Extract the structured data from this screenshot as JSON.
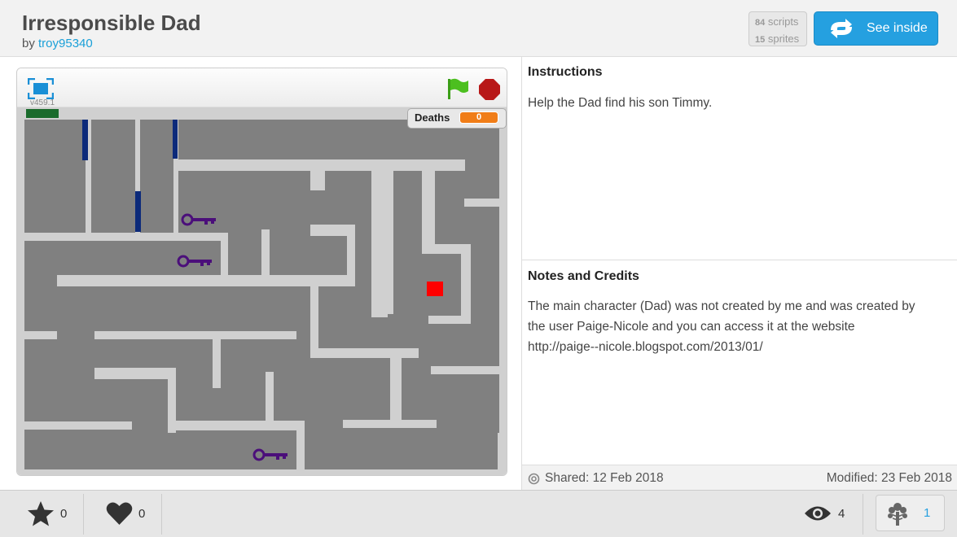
{
  "project": {
    "title": "Irresponsible Dad",
    "by_label": "by",
    "author": "troy95340"
  },
  "stats": {
    "scripts_count": "84",
    "scripts_label": "scripts",
    "sprites_count": "15",
    "sprites_label": "sprites"
  },
  "see_inside_label": "See inside",
  "player": {
    "version": "v459.1",
    "deaths_label": "Deaths",
    "deaths_value": "0"
  },
  "instructions": {
    "heading": "Instructions",
    "text": "Help the Dad find his son Timmy."
  },
  "notes": {
    "heading": "Notes and Credits",
    "lines": [
      "The main character (Dad) was not created by me and was created by",
      "the user Paige-Nicole and you can access it at the website",
      "http://paige--nicole.blogspot.com/2013/01/"
    ]
  },
  "meta": {
    "shared": "Shared: 12 Feb 2018",
    "modified": "Modified: 23 Feb 2018"
  },
  "bottom": {
    "favorites": "0",
    "loves": "0",
    "views": "4",
    "remixes": "1"
  },
  "colors": {
    "accent": "#25a0e0",
    "maze_wall": "#808080",
    "maze_path": "#d0d0d0",
    "key": "#4b0f7a",
    "door": "#0c2a7a",
    "goal": "#ff0000",
    "flag": "#4cbf1f",
    "stop": "#b81818"
  },
  "icons": [
    "fullscreen-icon",
    "green-flag-icon",
    "stop-icon",
    "key-icon",
    "star-icon",
    "heart-icon",
    "eye-icon",
    "remix-tree-icon",
    "shared-icon",
    "see-inside-arrows-icon"
  ]
}
